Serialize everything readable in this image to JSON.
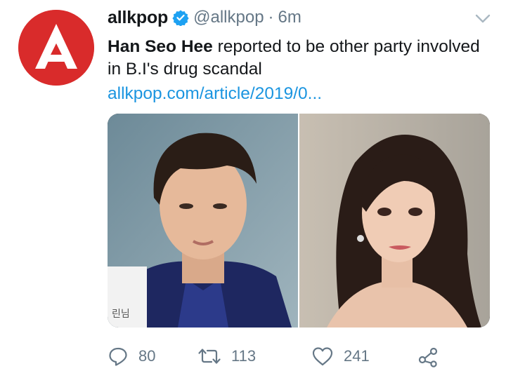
{
  "author": {
    "display_name": "allkpop",
    "handle": "@allkpop",
    "separator": "·",
    "time": "6m",
    "verified": true,
    "avatar_icon": "allkpop-logo-icon",
    "brand_color": "#d92b2b"
  },
  "tweet": {
    "text_bold": "Han Seo Hee",
    "text_rest": " reported to be other party involved in B.I's drug scandal",
    "link": "allkpop.com/article/2019/0...",
    "menu_icon": "chevron-down-icon"
  },
  "media": {
    "photos": [
      {
        "name": "photo-left"
      },
      {
        "name": "photo-right",
        "sign_text": "린님"
      }
    ]
  },
  "actions": {
    "reply": {
      "icon": "reply-icon",
      "count": "80"
    },
    "retweet": {
      "icon": "retweet-icon",
      "count": "113"
    },
    "like": {
      "icon": "heart-icon",
      "count": "241"
    },
    "share": {
      "icon": "share-icon"
    }
  },
  "colors": {
    "text": "#14171a",
    "muted": "#657786",
    "link": "#1b95e0",
    "verified": "#1da1f2"
  }
}
